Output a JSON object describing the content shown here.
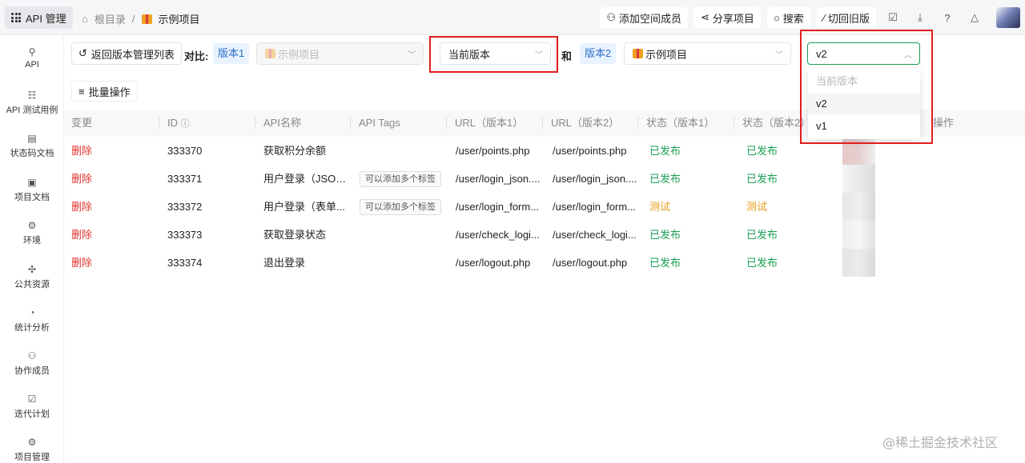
{
  "topbar": {
    "app_label": "API 管理",
    "breadcrumb_root": "根目录",
    "breadcrumb_sep": "/",
    "breadcrumb_current": "示例项目",
    "add_member": "添加空间成员",
    "share": "分享项目",
    "search": "搜索",
    "old_version": "切回旧版"
  },
  "sidebar": {
    "items": [
      "API",
      "API 测试用例",
      "状态码文档",
      "项目文档",
      "环境",
      "公共资源",
      "统计分析",
      "协作成员",
      "迭代计划",
      "项目管理"
    ]
  },
  "toolbar": {
    "back_label": "返回版本管理列表",
    "compare_label": "对比:",
    "version1_tag": "版本1",
    "project1": "示例项目",
    "version1_value": "当前版本",
    "and_label": "和",
    "version2_tag": "版本2",
    "project2": "示例项目",
    "version2_value": "v2"
  },
  "batch_label": "批量操作",
  "table": {
    "headers": [
      "变更",
      "ID",
      "API名称",
      "API Tags",
      "URL（版本1）",
      "URL（版本2）",
      "状态（版本1）",
      "状态（版本2）",
      "操作"
    ],
    "rows": [
      {
        "change": "删除",
        "id": "333370",
        "name": "获取积分余额",
        "tag": "",
        "url1": "/user/points.php",
        "url2": "/user/points.php",
        "s1": "已发布",
        "s2": "已发布",
        "s1type": "pub",
        "s2type": "pub"
      },
      {
        "change": "删除",
        "id": "333371",
        "name": "用户登录（JSON...",
        "tag": "可以添加多个标签",
        "url1": "/user/login_json....",
        "url2": "/user/login_json....",
        "s1": "已发布",
        "s2": "已发布",
        "s1type": "pub",
        "s2type": "pub"
      },
      {
        "change": "删除",
        "id": "333372",
        "name": "用户登录（表单...",
        "tag": "可以添加多个标签",
        "url1": "/user/login_form...",
        "url2": "/user/login_form...",
        "s1": "测试",
        "s2": "测试",
        "s1type": "test",
        "s2type": "test"
      },
      {
        "change": "删除",
        "id": "333373",
        "name": "获取登录状态",
        "tag": "",
        "url1": "/user/check_logi...",
        "url2": "/user/check_logi...",
        "s1": "已发布",
        "s2": "已发布",
        "s1type": "pub",
        "s2type": "pub"
      },
      {
        "change": "删除",
        "id": "333374",
        "name": "退出登录",
        "tag": "",
        "url1": "/user/logout.php",
        "url2": "/user/logout.php",
        "s1": "已发布",
        "s2": "已发布",
        "s1type": "pub",
        "s2type": "pub"
      }
    ]
  },
  "dropdown": {
    "options": [
      "当前版本",
      "v2",
      "v1"
    ],
    "selected": "v2"
  },
  "watermark": "@稀土掘金技术社区",
  "colors": {
    "deleted": "#e0342f",
    "published": "#1a9e56",
    "testing": "#e89b1b",
    "highlight_box": "#e11d1d",
    "version_tag_bg": "#e9f3ff"
  }
}
